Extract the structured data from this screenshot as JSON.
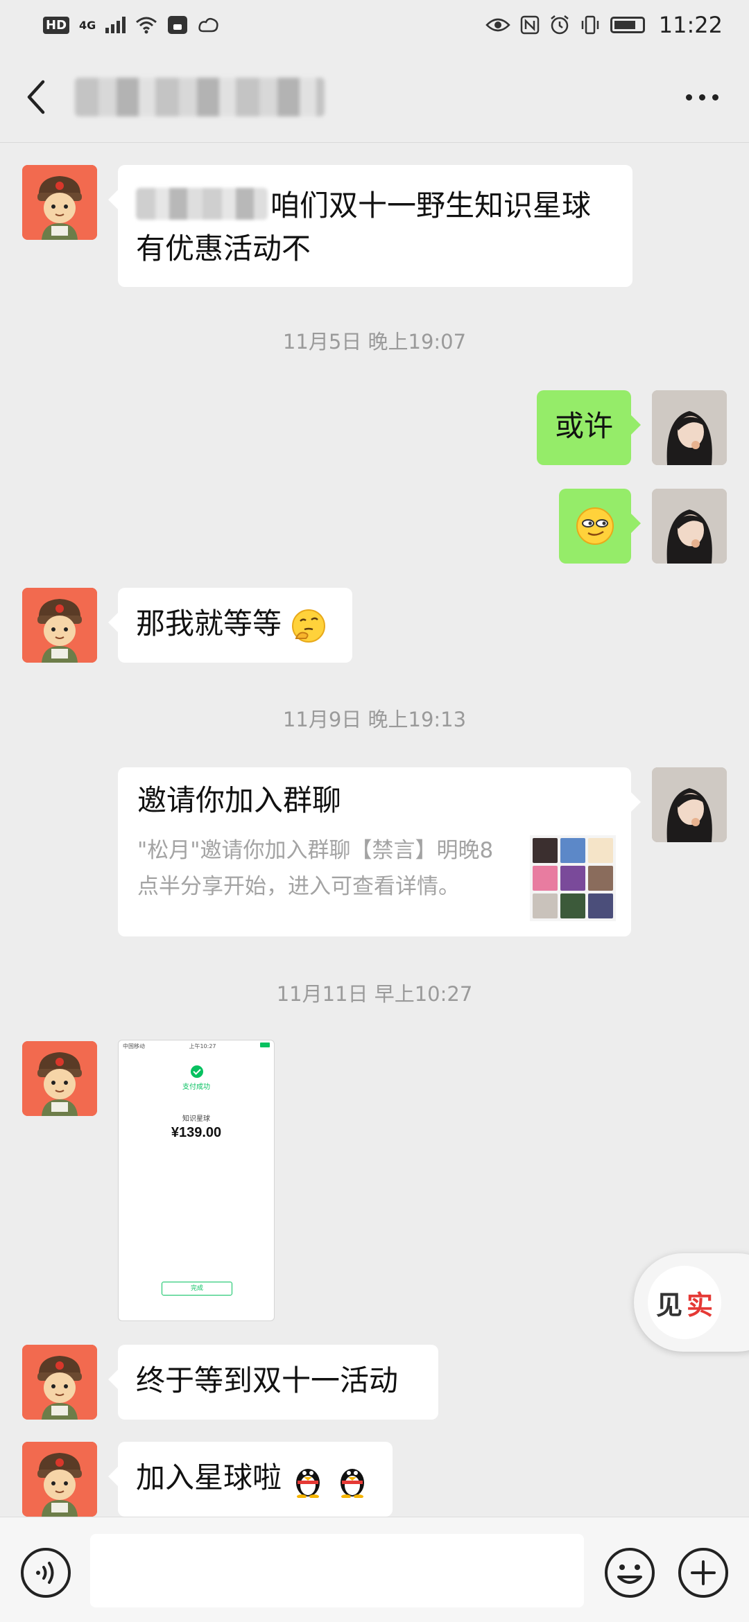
{
  "status_bar": {
    "hd": "HD",
    "network": "4G",
    "time": "11:22"
  },
  "header": {
    "back_icon": "chevron-left-icon",
    "more_icon": "more-icon"
  },
  "messages": [
    {
      "side": "left",
      "text": "咱们双十一野生知识星球有优惠活动不"
    },
    {
      "type": "time",
      "text": "11月5日 晚上19:07"
    },
    {
      "side": "right",
      "text": "或许"
    },
    {
      "side": "right",
      "emoji": "smirk-emoji"
    },
    {
      "side": "left",
      "text": "那我就等等",
      "emoji": "thinking-emoji"
    },
    {
      "type": "time",
      "text": "11月9日 晚上19:13"
    },
    {
      "side": "right",
      "type": "group-invite",
      "title": "邀请你加入群聊",
      "desc": "\"松月\"邀请你加入群聊【禁言】明晚8点半分享开始，进入可查看详情。"
    },
    {
      "type": "time",
      "text": "11月11日 早上10:27"
    },
    {
      "side": "left",
      "type": "image",
      "payment": {
        "carrier": "中国移动",
        "time": "上午10:27",
        "status": "支付成功",
        "item": "知识星球",
        "amount": "¥139.00",
        "done_label": "完成"
      }
    },
    {
      "side": "left",
      "text": "终于等到双十一活动"
    },
    {
      "side": "left",
      "text": "加入星球啦",
      "emoji": "penguin-emoji"
    }
  ],
  "floating_button": {
    "label_1": "见",
    "label_2": "实"
  },
  "input_bar": {
    "voice_icon": "voice-icon",
    "emoji_icon": "emoji-icon",
    "plus_icon": "plus-icon"
  }
}
